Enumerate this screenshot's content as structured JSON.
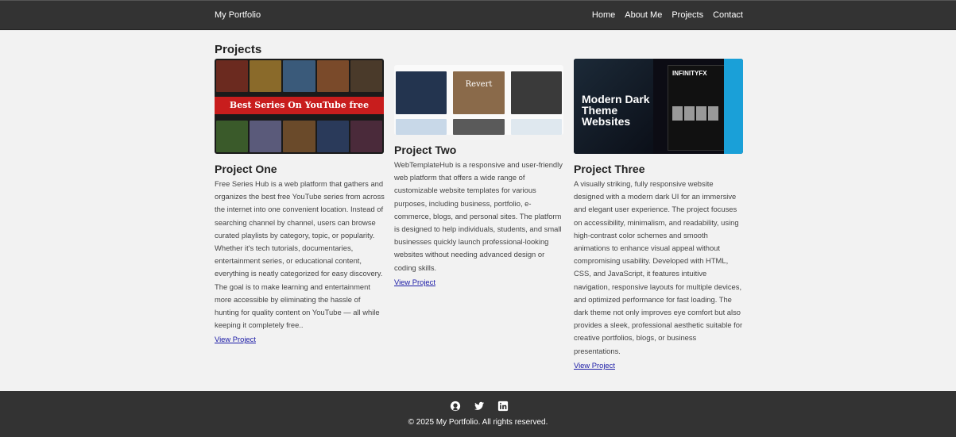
{
  "header": {
    "brand": "My Portfolio",
    "nav": [
      {
        "label": "Home"
      },
      {
        "label": "About Me"
      },
      {
        "label": "Projects"
      },
      {
        "label": "Contact"
      }
    ]
  },
  "main": {
    "section_title": "Projects",
    "projects": [
      {
        "title": "Project One",
        "thumb_text": "Best Series On YouTube free",
        "description": "Free Series Hub is a web platform that gathers and organizes the best free YouTube series from across the internet into one convenient location. Instead of searching channel by channel, users can browse curated playlists by category, topic, or popularity. Whether it's tech tutorials, documentaries, entertainment series, or educational content, everything is neatly categorized for easy discovery. The goal is to make learning and entertainment more accessible by eliminating the hassle of hunting for quality content on YouTube — all while keeping it completely free..",
        "link": "View Project"
      },
      {
        "title": "Project Two",
        "thumb_text": "Revert",
        "description": "WebTemplateHub is a responsive and user-friendly web platform that offers a wide range of customizable website templates for various purposes, including business, portfolio, e-commerce, blogs, and personal sites. The platform is designed to help individuals, students, and small businesses quickly launch professional-looking websites without needing advanced design or coding skills.",
        "link": "View Project"
      },
      {
        "title": "Project Three",
        "thumb_text": "Modern Dark Theme Websites",
        "thumb_logo": "INFINITYFX",
        "description": "A visually striking, fully responsive website designed with a modern dark UI for an immersive and elegant user experience. The project focuses on accessibility, minimalism, and readability, using high-contrast color schemes and smooth animations to enhance visual appeal without compromising usability. Developed with HTML, CSS, and JavaScript, it features intuitive navigation, responsive layouts for multiple devices, and optimized performance for fast loading. The dark theme not only improves eye comfort but also provides a sleek, professional aesthetic suitable for creative portfolios, blogs, or business presentations.",
        "link": "View Project"
      }
    ]
  },
  "footer": {
    "socials": [
      "github-icon",
      "twitter-icon",
      "linkedin-icon"
    ],
    "copyright": "© 2025 My Portfolio. All rights reserved."
  },
  "colors": {
    "header_bg": "#333333",
    "page_bg": "#f2f2f2",
    "link": "#1a1aa6",
    "banner_red": "#c81d1d"
  }
}
